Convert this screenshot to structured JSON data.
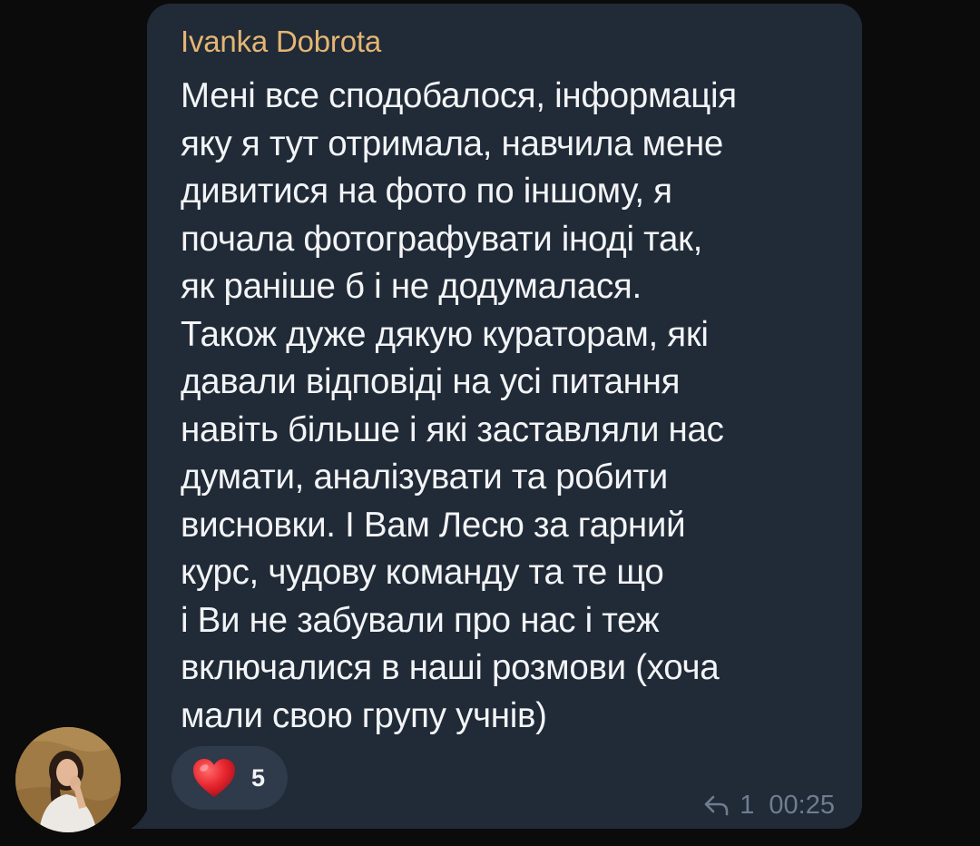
{
  "message": {
    "sender": "Ivanka Dobrota",
    "lines": [
      "Мені все сподобалося, інформація",
      "яку я тут отримала, навчила мене",
      "дивитися на фото по іншому, я",
      "почала фотографувати іноді так,",
      "як раніше б і не додумалася.",
      "Також дуже дякую кураторам, які",
      "давали відповіді на усі питання",
      "навіть більше і які заставляли нас",
      "думати, аналізувати та робити",
      "висновки. І Вам Лесю за гарний",
      "курс, чудову команду та те що",
      "і Ви не забували про нас і теж",
      "включалися в наші розмови (хоча",
      "мали свою групу учнів)"
    ],
    "reaction": {
      "icon": "heart-icon",
      "count": "5"
    },
    "replies": {
      "icon": "reply-icon",
      "count": "1"
    },
    "time": "00:25"
  },
  "colors": {
    "background": "#0b0b0c",
    "bubble": "#212a37",
    "sender_name": "#e4b673",
    "text": "#f2f4f6",
    "reaction_pill": "#2f3a4a",
    "heart": "#e8262f",
    "meta": "#6f7d91"
  }
}
